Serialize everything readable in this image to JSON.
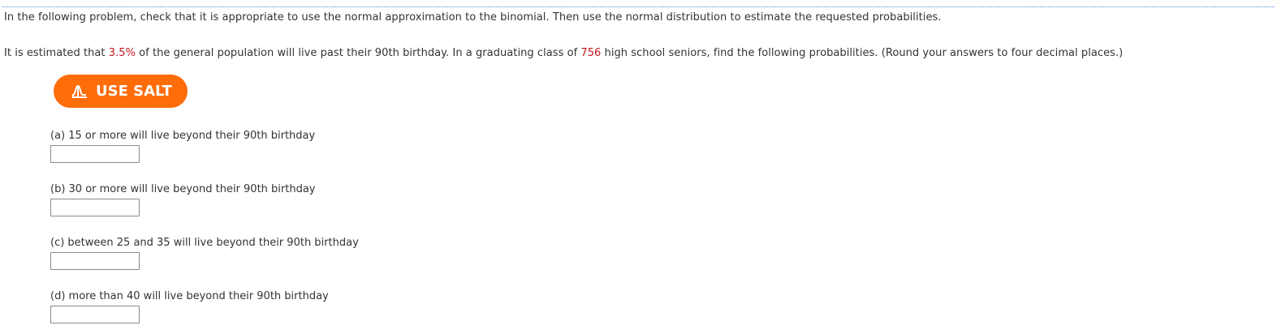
{
  "instructions": "In the following problem, check that it is appropriate to use the normal approximation to the binomial. Then use the normal distribution to estimate the requested probabilities.",
  "problem": {
    "prefix": "It is estimated that ",
    "percent": "3.5%",
    "middle": " of the general population will live past their 90th birthday. In a graduating class of ",
    "class_size": "756",
    "suffix": " high school seniors, find the following probabilities. (Round your answers to four decimal places.)"
  },
  "salt_button": {
    "label": "USE SALT",
    "icon": "bell-curve-icon",
    "color": "#ff6c0a"
  },
  "questions": [
    {
      "label": "(a) 15 or more will live beyond their 90th birthday",
      "value": ""
    },
    {
      "label": "(b) 30 or more will live beyond their 90th birthday",
      "value": ""
    },
    {
      "label": "(c) between 25 and 35 will live beyond their 90th birthday",
      "value": ""
    },
    {
      "label": "(d) more than 40 will live beyond their 90th birthday",
      "value": ""
    }
  ],
  "colors": {
    "highlight": "#c4161c",
    "border": "#4a8fd6"
  }
}
